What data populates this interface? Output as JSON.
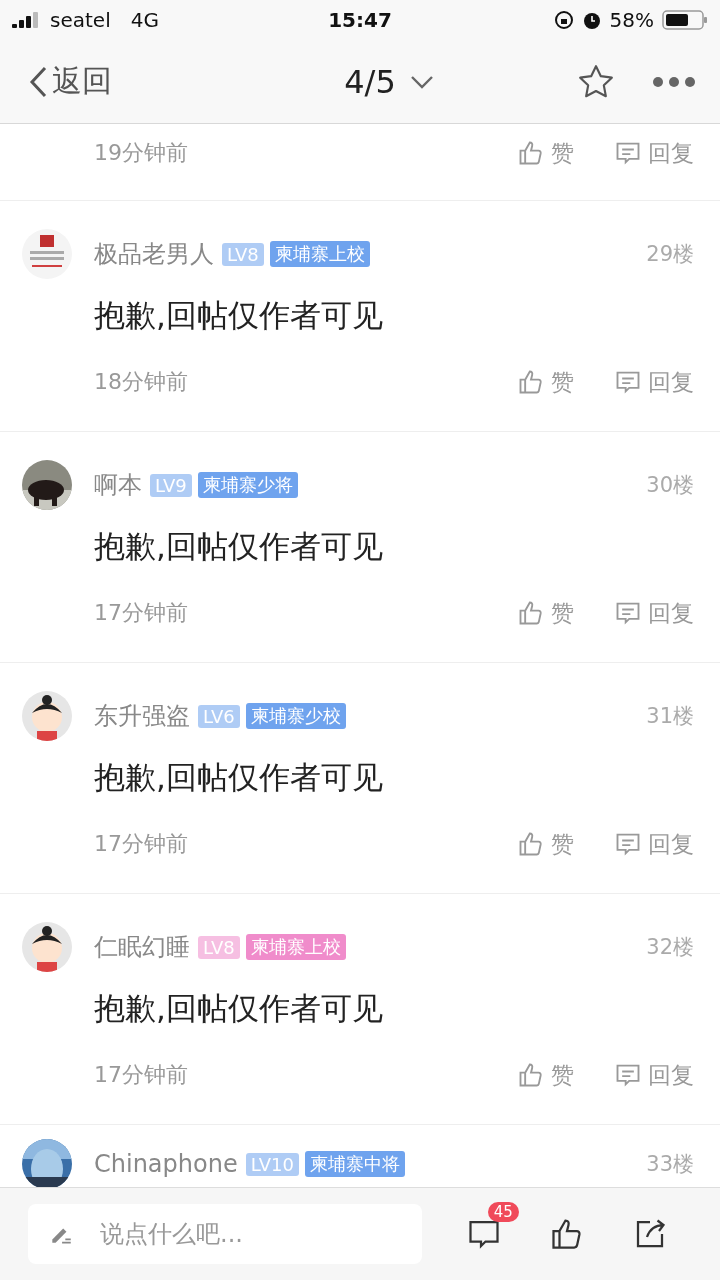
{
  "status_bar": {
    "carrier": "seatel",
    "network": "4G",
    "time": "15:47",
    "battery": "58%"
  },
  "nav": {
    "back": "返回",
    "page": "4/5"
  },
  "posts": [
    {
      "time": "19分钟前",
      "like": "赞",
      "reply": "回复"
    },
    {
      "name": "极品老男人",
      "level": "LV8",
      "rank": "柬埔寨上校",
      "color": "#6fa3ee",
      "floor": "29楼",
      "content": "抱歉,回帖仅作者可见",
      "time": "18分钟前",
      "like": "赞",
      "reply": "回复"
    },
    {
      "name": "啊本",
      "level": "LV9",
      "rank": "柬埔寨少将",
      "color": "#6fa3ee",
      "floor": "30楼",
      "content": "抱歉,回帖仅作者可见",
      "time": "17分钟前",
      "like": "赞",
      "reply": "回复"
    },
    {
      "name": "东升强盗",
      "level": "LV6",
      "rank": "柬埔寨少校",
      "color": "#6fa3ee",
      "floor": "31楼",
      "content": "抱歉,回帖仅作者可见",
      "time": "17分钟前",
      "like": "赞",
      "reply": "回复"
    },
    {
      "name": "仁眠幻睡",
      "level": "LV8",
      "rank": "柬埔寨上校",
      "color": "#f08ccb",
      "floor": "32楼",
      "content": "抱歉,回帖仅作者可见",
      "time": "17分钟前",
      "like": "赞",
      "reply": "回复"
    },
    {
      "name": "Chinaphone",
      "level": "LV10",
      "rank": "柬埔寨中将",
      "color": "#6fa3ee",
      "floor": "33楼"
    }
  ],
  "composer": {
    "placeholder": "说点什么吧...",
    "badge": "45"
  }
}
